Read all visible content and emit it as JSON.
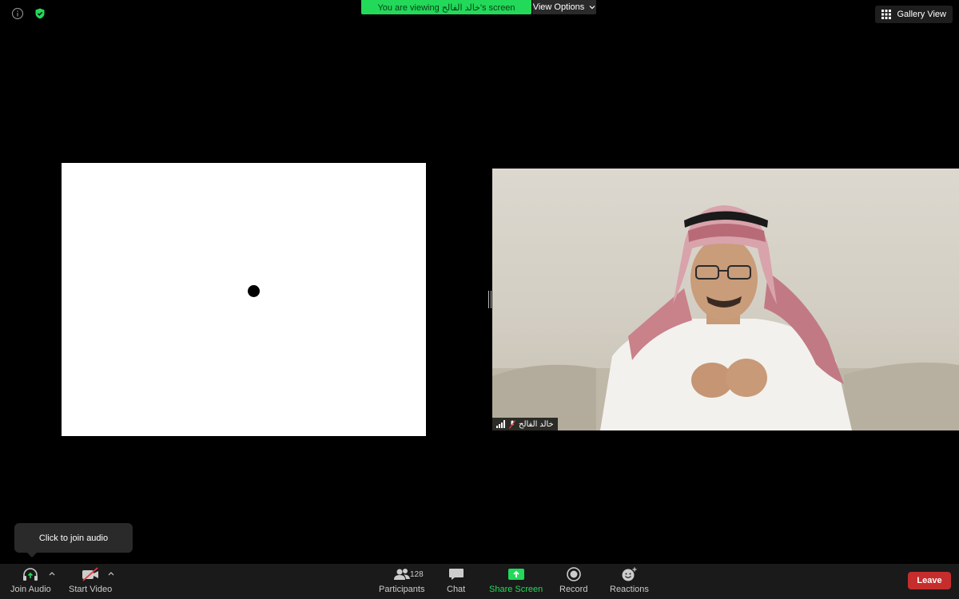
{
  "top_bar": {
    "banner_text": "You are viewing خالد الفالح's screen",
    "view_options_label": "View Options",
    "gallery_view_label": "Gallery View"
  },
  "participant": {
    "name": "خالد الفالح"
  },
  "tooltip": {
    "text": "Click to join audio"
  },
  "toolbar": {
    "join_audio_label": "Join Audio",
    "start_video_label": "Start Video",
    "participants_label": "Participants",
    "participants_count": "128",
    "chat_label": "Chat",
    "share_screen_label": "Share Screen",
    "record_label": "Record",
    "reactions_label": "Reactions",
    "leave_label": "Leave"
  },
  "colors": {
    "share_green": "#23d959",
    "leave_red": "#c62d2d",
    "toolbar_bg": "#1a1a1a"
  }
}
